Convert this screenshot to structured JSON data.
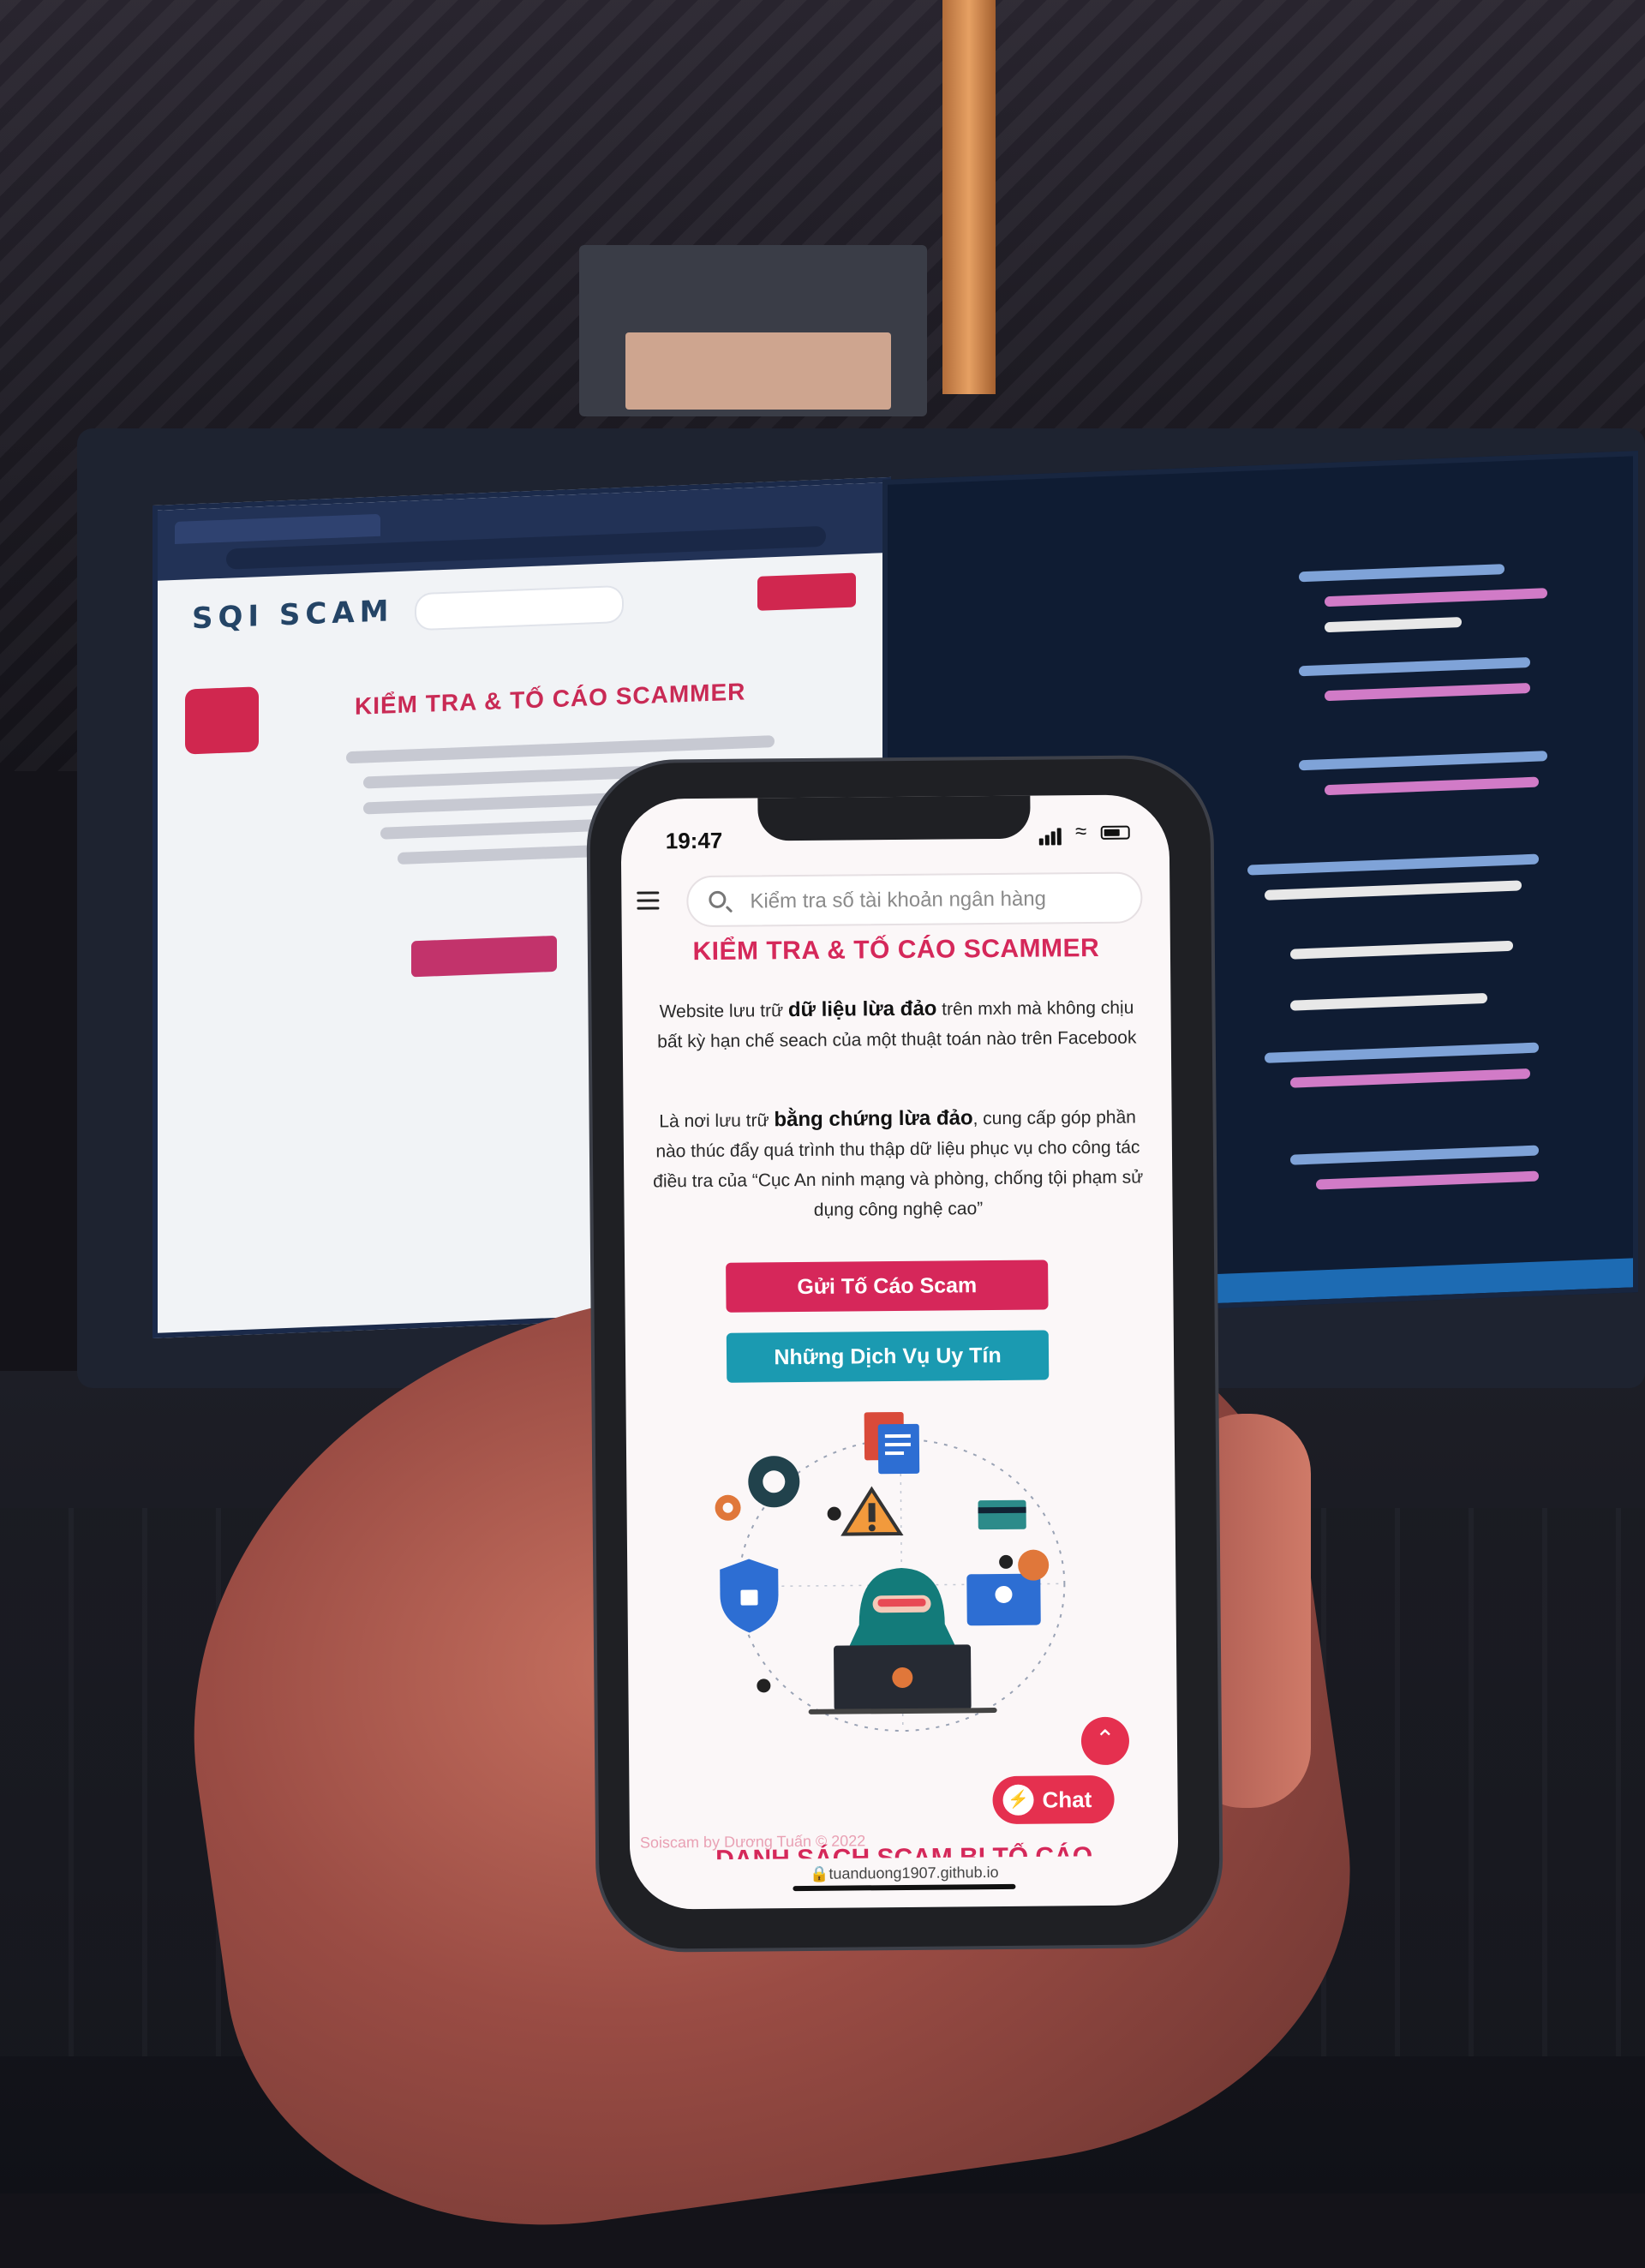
{
  "desktop": {
    "site_logo": "SQI SCAM",
    "site_heading": "KIỂM TRA & TỐ CÁO SCAMMER"
  },
  "phone": {
    "status_bar": {
      "time": "19:47"
    },
    "search": {
      "placeholder": "Kiểm tra số tài khoản ngân hàng"
    },
    "title": "KIỂM TRA & TỐ CÁO SCAMMER",
    "paragraph_1": {
      "pre": "Website lưu trữ ",
      "bold": "dữ liệu lừa đảo",
      "post": " trên mxh mà không chịu bất kỳ hạn chế seach của một thuật toán nào trên Facebook"
    },
    "paragraph_2": {
      "pre": "Là nơi lưu trữ ",
      "bold": "bằng chứng lừa đảo",
      "post": ", cung cấp góp phần nào thúc đẩy quá trình thu thập dữ liệu phục vụ cho công tác điều tra của “Cục An ninh mạng và phòng, chống tội phạm sử dụng công nghệ cao”"
    },
    "buttons": {
      "report": "Gửi Tố Cáo Scam",
      "trusted": "Những Dịch Vụ Uy Tín"
    },
    "chat_label": "Chat",
    "footer_credit": "Soiscam by Dương Tuấn © 2022",
    "section_heading": "DANH SÁCH SCAM BỊ TỐ CÁO",
    "url": "tuanduong1907.github.io",
    "icons": [
      "menu-icon",
      "search-icon",
      "wifi-icon",
      "battery-icon",
      "messenger-icon",
      "arrow-up-icon",
      "lock-icon"
    ]
  },
  "colors": {
    "accent_red": "#d6275a",
    "accent_teal": "#1b9ab1",
    "chat_red": "#e5304f"
  }
}
